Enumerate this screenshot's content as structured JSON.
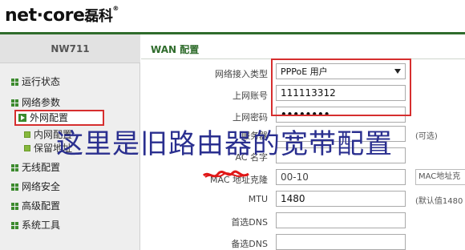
{
  "brand": {
    "logo_text": "net·core",
    "logo_cn": "磊科",
    "reg": "®"
  },
  "sidebar": {
    "model": "NW711",
    "items": [
      {
        "label": "运行状态"
      },
      {
        "label": "网络参数"
      },
      {
        "label": "外网配置"
      },
      {
        "label": "内网配置"
      },
      {
        "label": "保留地址"
      },
      {
        "label": "无线配置"
      },
      {
        "label": "网络安全"
      },
      {
        "label": "高级配置"
      },
      {
        "label": "系统工具"
      }
    ]
  },
  "main": {
    "title": "WAN 配置",
    "fields": [
      {
        "label": "网络接入类型",
        "value": "PPPoE 用户"
      },
      {
        "label": "上网账号",
        "value": "111113312"
      },
      {
        "label": "上网密码",
        "value": "••••••••"
      },
      {
        "label": "服务器",
        "value": ""
      },
      {
        "label": "AC 名字",
        "value": ""
      },
      {
        "label": "MAC 地址克隆",
        "value": "00-10",
        "side_value": "MAC地址克"
      },
      {
        "label": "MTU",
        "value": "1480",
        "side_note": "(默认值1480"
      },
      {
        "label": "首选DNS",
        "value": ""
      },
      {
        "label": "备选DNS",
        "value": ""
      }
    ],
    "side_note_top": "(可选)"
  },
  "annotation": {
    "text": "这里是旧路由器的宽带配置"
  },
  "colors": {
    "accent_green": "#2f6c2c",
    "highlight_red": "#d62e2e",
    "annotation_blue": "#2a2f8f"
  }
}
